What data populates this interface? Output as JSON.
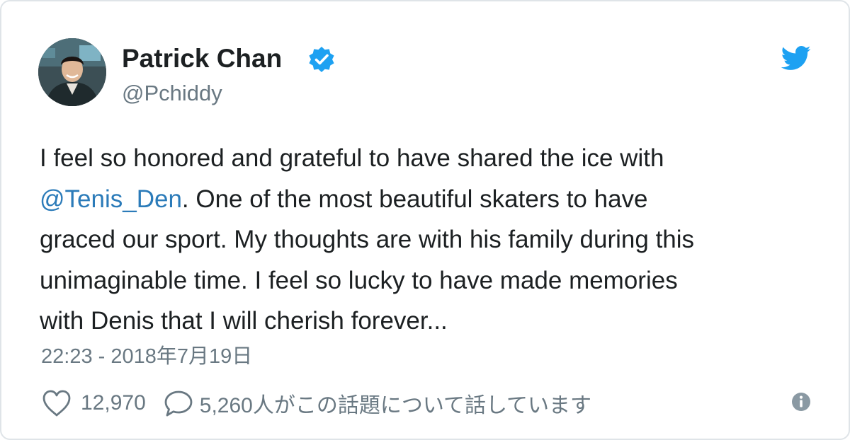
{
  "author": {
    "display_name": "Patrick Chan",
    "handle": "@Pchiddy",
    "verified": true
  },
  "tweet": {
    "lines": [
      {
        "segments": [
          {
            "text": "I feel so honored and grateful to have shared the ice with",
            "mention": false
          }
        ]
      },
      {
        "segments": [
          {
            "text": "@Tenis_Den",
            "mention": true
          },
          {
            "text": ". One of the most beautiful skaters to have",
            "mention": false
          }
        ]
      },
      {
        "segments": [
          {
            "text": "graced our sport. My thoughts are with his family during this",
            "mention": false
          }
        ]
      },
      {
        "segments": [
          {
            "text": "unimaginable time. I feel so lucky to have made memories",
            "mention": false
          }
        ]
      },
      {
        "segments": [
          {
            "text": "with Denis that I will cherish forever...",
            "mention": false
          }
        ]
      }
    ],
    "timestamp": "22:23 - 2018年7月19日"
  },
  "actions": {
    "like_count": "12,970",
    "reply_text": "5,260人がこの話題について話しています"
  },
  "icons": {
    "verified": "verified-badge-icon",
    "brand": "twitter-bird-icon",
    "like": "heart-icon",
    "reply": "speech-bubble-icon",
    "info": "info-icon"
  },
  "colors": {
    "brand_blue": "#1da1f2",
    "mention": "#2b7bb9",
    "secondary_text": "#697882",
    "primary_text": "#1c2022",
    "border": "#dfe4e8"
  }
}
